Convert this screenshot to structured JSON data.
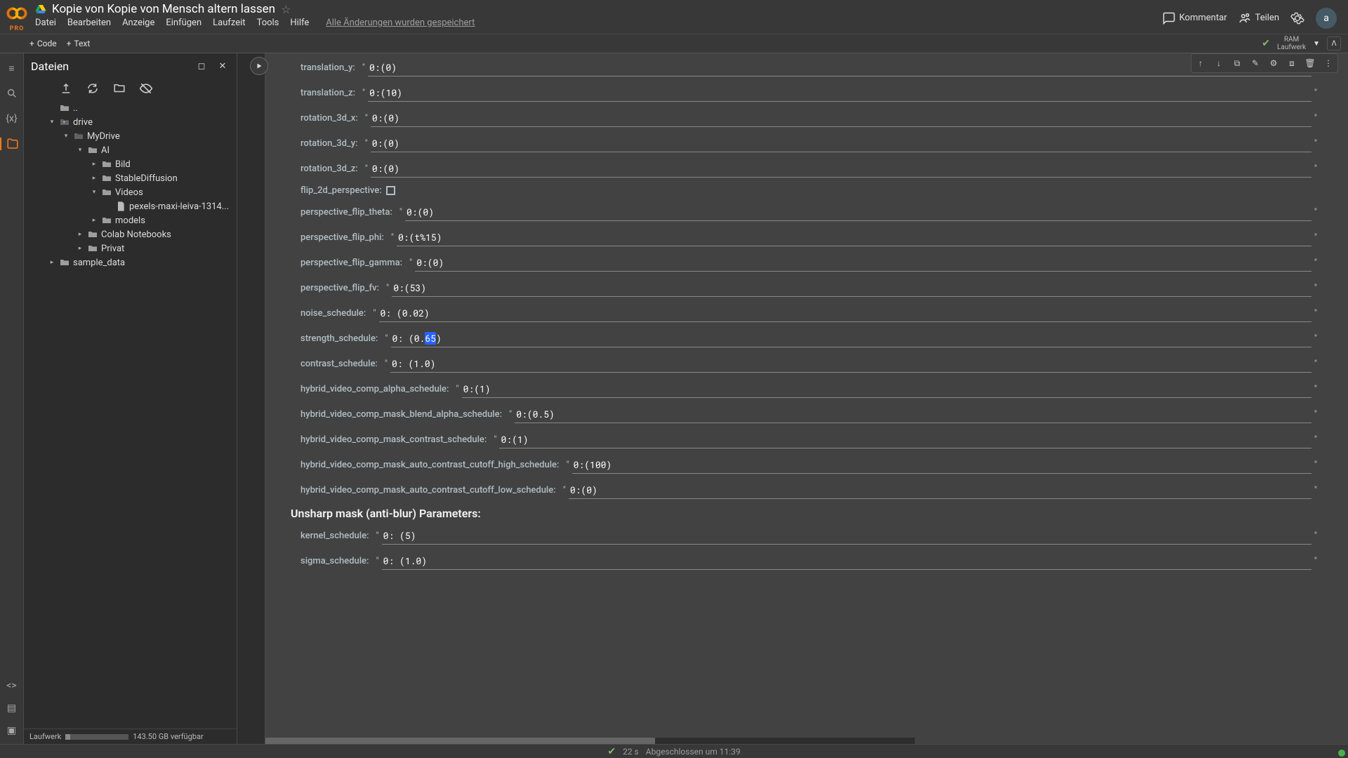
{
  "header": {
    "pro": "PRO",
    "title": "Kopie von Kopie von Mensch altern lassen",
    "menus": [
      "Datei",
      "Bearbeiten",
      "Anzeige",
      "Einfügen",
      "Laufzeit",
      "Tools",
      "Hilfe"
    ],
    "saved": "Alle Änderungen wurden gespeichert",
    "kommentar": "Kommentar",
    "teilen": "Teilen",
    "avatar": "a"
  },
  "toolbar": {
    "code": "Code",
    "text": "Text",
    "ram": "RAM",
    "laufwerk": "Laufwerk"
  },
  "sidebar": {
    "title": "Dateien",
    "dots": "..",
    "tree": {
      "drive": "drive",
      "mydrive": "MyDrive",
      "ai": "AI",
      "bild": "Bild",
      "sd": "StableDiffusion",
      "videos": "Videos",
      "videofile": "pexels-maxi-leiva-1314...",
      "models": "models",
      "colab": "Colab Notebooks",
      "privat": "Privat",
      "sample": "sample_data"
    },
    "footer_label": "Laufwerk",
    "footer_free": "143.50 GB verfügbar"
  },
  "params": [
    {
      "label": "translation_y:",
      "value": "0:(0)"
    },
    {
      "label": "translation_z:",
      "value": "0:(10)"
    },
    {
      "label": "rotation_3d_x:",
      "value": "0:(0)"
    },
    {
      "label": "rotation_3d_y:",
      "value": "0:(0)"
    },
    {
      "label": "rotation_3d_z:",
      "value": "0:(0)"
    },
    {
      "label": "flip_2d_perspective:",
      "type": "checkbox"
    },
    {
      "label": "perspective_flip_theta:",
      "value": "0:(0)"
    },
    {
      "label": "perspective_flip_phi:",
      "value": "0:(t%15)"
    },
    {
      "label": "perspective_flip_gamma:",
      "value": "0:(0)"
    },
    {
      "label": "perspective_flip_fv:",
      "value": "0:(53)"
    },
    {
      "label": "noise_schedule:",
      "value": "0: (0.02)"
    },
    {
      "label": "strength_schedule:",
      "value": "0: (0.65)",
      "active": true
    },
    {
      "label": "contrast_schedule:",
      "value": "0: (1.0)"
    },
    {
      "label": "hybrid_video_comp_alpha_schedule:",
      "value": "0:(1)"
    },
    {
      "label": "hybrid_video_comp_mask_blend_alpha_schedule:",
      "value": "0:(0.5)"
    },
    {
      "label": "hybrid_video_comp_mask_contrast_schedule:",
      "value": "0:(1)"
    },
    {
      "label": "hybrid_video_comp_mask_auto_contrast_cutoff_high_schedule:",
      "value": "0:(100)"
    },
    {
      "label": "hybrid_video_comp_mask_auto_contrast_cutoff_low_schedule:",
      "value": "0:(0)"
    }
  ],
  "section_heading": "Unsharp mask (anti-blur) Parameters:",
  "params2": [
    {
      "label": "kernel_schedule:",
      "value": "0: (5)"
    },
    {
      "label": "sigma_schedule:",
      "value": "0: (1.0)"
    }
  ],
  "status": {
    "time": "22 s",
    "done": "Abgeschlossen um 11:39"
  }
}
